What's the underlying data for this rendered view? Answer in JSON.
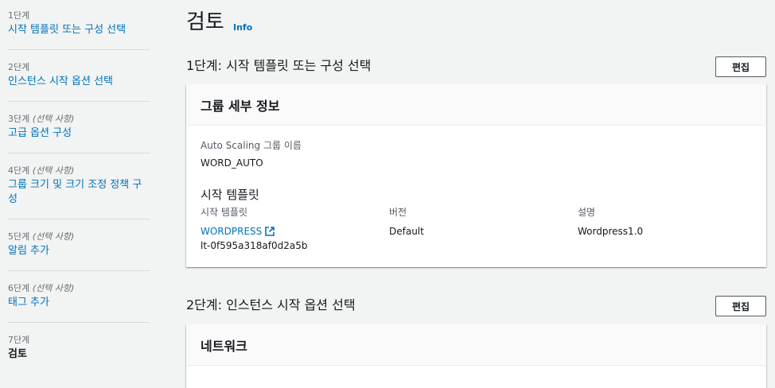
{
  "steps": [
    {
      "num": "1단계",
      "opt": "",
      "title": "시작 템플릿 또는 구성 선택"
    },
    {
      "num": "2단계",
      "opt": "",
      "title": "인스턴스 시작 옵션 선택"
    },
    {
      "num": "3단계",
      "opt": "(선택 사항)",
      "title": "고급 옵션 구성"
    },
    {
      "num": "4단계",
      "opt": "(선택 사항)",
      "title_line1": "그룹 크기 및 크기 조정 정책 구",
      "title_line2": "성"
    },
    {
      "num": "5단계",
      "opt": "(선택 사항)",
      "title": "알림 추가"
    },
    {
      "num": "6단계",
      "opt": "(선택 사항)",
      "title": "태그 추가"
    },
    {
      "num": "7단계",
      "opt": "",
      "title": "검토"
    }
  ],
  "page": {
    "title": "검토",
    "info": "Info"
  },
  "section1": {
    "heading": "1단계: 시작 템플릿 또는 구성 선택",
    "edit": "편집",
    "card_title": "그룹 세부 정보",
    "asg_label": "Auto Scaling 그룹 이름",
    "asg_value": "WORD_AUTO",
    "lt_heading": "시작 템플릿",
    "col_template": "시작 템플릿",
    "col_version": "버전",
    "col_desc": "설명",
    "template_name": "WORDPRESS",
    "template_id": "lt-0f595a318af0d2a5b",
    "version": "Default",
    "description": "Wordpress1.0"
  },
  "section2": {
    "heading": "2단계: 인스턴스 시작 옵션 선택",
    "edit": "편집",
    "card_title": "네트워크"
  },
  "colors": {
    "link": "#0073bb",
    "bg": "#f2f3f3"
  }
}
